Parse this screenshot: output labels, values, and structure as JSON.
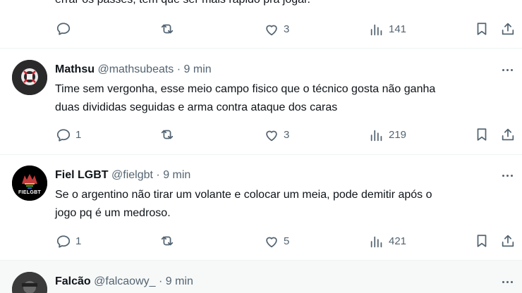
{
  "top_fragment": {
    "text": "errar os passes, tem que ser mais rápido pra jogar.",
    "stats": {
      "replies": "",
      "reposts": "",
      "likes": "3",
      "views": "141"
    }
  },
  "tweets": [
    {
      "name": "Mathsu",
      "handle": "@mathsubeats",
      "separator": "·",
      "time": "9 min",
      "text": "Time sem vergonha, esse meio campo fisico que o técnico gosta não ganha\nduas divididas seguidas e arma contra ataque dos caras",
      "stats": {
        "replies": "1",
        "reposts": "",
        "likes": "3",
        "views": "219"
      }
    },
    {
      "name": "Fiel LGBT",
      "handle": "@fielgbt",
      "separator": "·",
      "time": "9 min",
      "avatar_text": "FIELGBT",
      "text": "Se o argentino não tirar um volante e colocar um meia, pode demitir após o\njogo pq é um medroso.",
      "stats": {
        "replies": "1",
        "reposts": "",
        "likes": "5",
        "views": "421"
      }
    },
    {
      "name": "Falcão",
      "handle": "@falcaowy_",
      "separator": "·",
      "time": "9 min"
    }
  ],
  "icons": [
    "reply-icon",
    "repost-icon",
    "like-icon",
    "views-icon",
    "bookmark-icon",
    "share-icon",
    "more-icon"
  ],
  "colors": {
    "secondary_text": "#536471",
    "divider": "#eff3f4",
    "highlight_bg": "#f7f9f9"
  }
}
